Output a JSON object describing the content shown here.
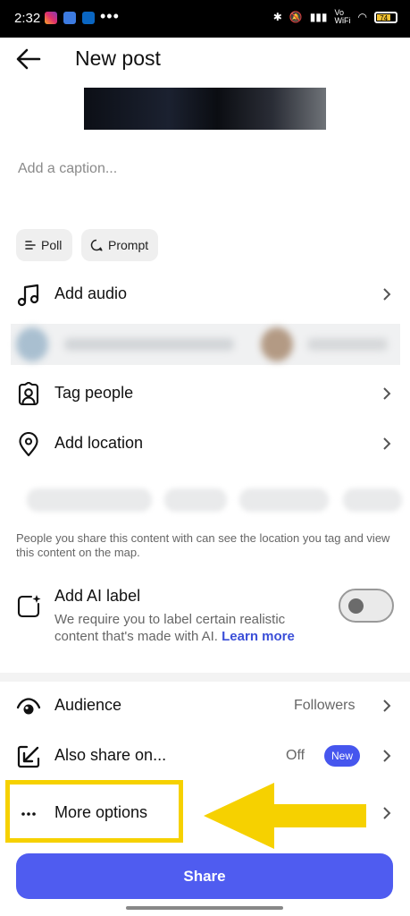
{
  "status_bar": {
    "time": "2:32",
    "dots": "•••",
    "network_label": "Vo WiFi",
    "battery": "74"
  },
  "header": {
    "title": "New post"
  },
  "caption": {
    "placeholder": "Add a caption..."
  },
  "chips": [
    {
      "label": "Poll",
      "icon": "poll-icon"
    },
    {
      "label": "Prompt",
      "icon": "prompt-icon"
    }
  ],
  "rows": {
    "add_audio": "Add audio",
    "tag_people": "Tag people",
    "add_location": "Add location",
    "audience": "Audience",
    "audience_value": "Followers",
    "also_share": "Also share on...",
    "also_share_value": "Off",
    "also_share_badge": "New",
    "more_options": "More options"
  },
  "location_note": "People you share this content with can see the location you tag and view this content on the map.",
  "ai_label": {
    "title": "Add AI label",
    "description": "We require you to label certain realistic content that's made with AI.",
    "link": "Learn more",
    "enabled": false
  },
  "share_button": "Share",
  "colors": {
    "accent": "#4f5cf0",
    "link": "#3b4fd8",
    "annotation": "#f6d100"
  }
}
